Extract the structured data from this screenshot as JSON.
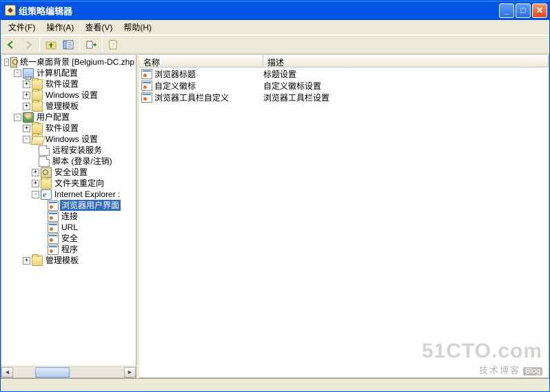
{
  "window": {
    "title": "组策略编辑器"
  },
  "menu": {
    "file": "文件(F)",
    "action": "操作(A)",
    "view": "查看(V)",
    "help": "帮助(H)"
  },
  "tree": {
    "root": "统一桌面背景 [Belgium-DC.zhp",
    "computer_cfg": "计算机配置",
    "soft_settings1": "软件设置",
    "win_settings1": "Windows 设置",
    "admin_tmpl1": "管理模板",
    "user_cfg": "用户配置",
    "soft_settings2": "软件设置",
    "win_settings2": "Windows 设置",
    "remote_install": "远程安装服务",
    "scripts": "脚本 (登录/注销)",
    "security": "安全设置",
    "folder_redir": "文件夹重定向",
    "ie_maint": "Internet Explorer :",
    "browser_ui": "浏览器用户界面",
    "connections": "连接",
    "url": "URL",
    "ie_security": "安全",
    "programs": "程序",
    "admin_tmpl2": "管理模板"
  },
  "list": {
    "col_name": "名称",
    "col_desc": "描述",
    "rows": [
      {
        "name": "浏览器标题",
        "desc": "标题设置"
      },
      {
        "name": "自定义徽标",
        "desc": "自定义徽标设置"
      },
      {
        "name": "浏览器工具栏自定义",
        "desc": "浏览器工具栏设置"
      }
    ]
  },
  "watermark": {
    "main": "51CTO.com",
    "sub": "技术博客",
    "blog": "Blog"
  }
}
